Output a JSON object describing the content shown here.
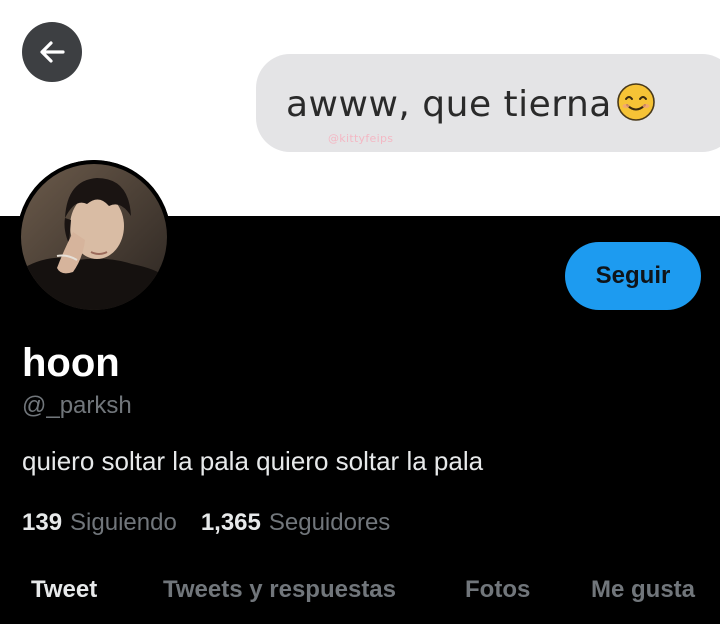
{
  "header": {
    "message_text": "awww, que tierna",
    "watermark": "@kittyfeips",
    "back_icon": "arrow-left-icon"
  },
  "profile": {
    "display_name": "hoon",
    "handle": "@_parksh",
    "bio": "quiero soltar la pala quiero soltar la pala",
    "follow_label": "Seguir",
    "following_count": "139",
    "following_label": "Siguiendo",
    "followers_count": "1,365",
    "followers_label": "Seguidores"
  },
  "tabs": [
    {
      "label": "Tweet",
      "active": true
    },
    {
      "label": "Tweets y respuestas",
      "active": false
    },
    {
      "label": "Fotos",
      "active": false
    },
    {
      "label": "Me gusta",
      "active": false
    }
  ],
  "colors": {
    "accent": "#1d9bf0",
    "background": "#000000",
    "secondary_text": "#71767b"
  }
}
